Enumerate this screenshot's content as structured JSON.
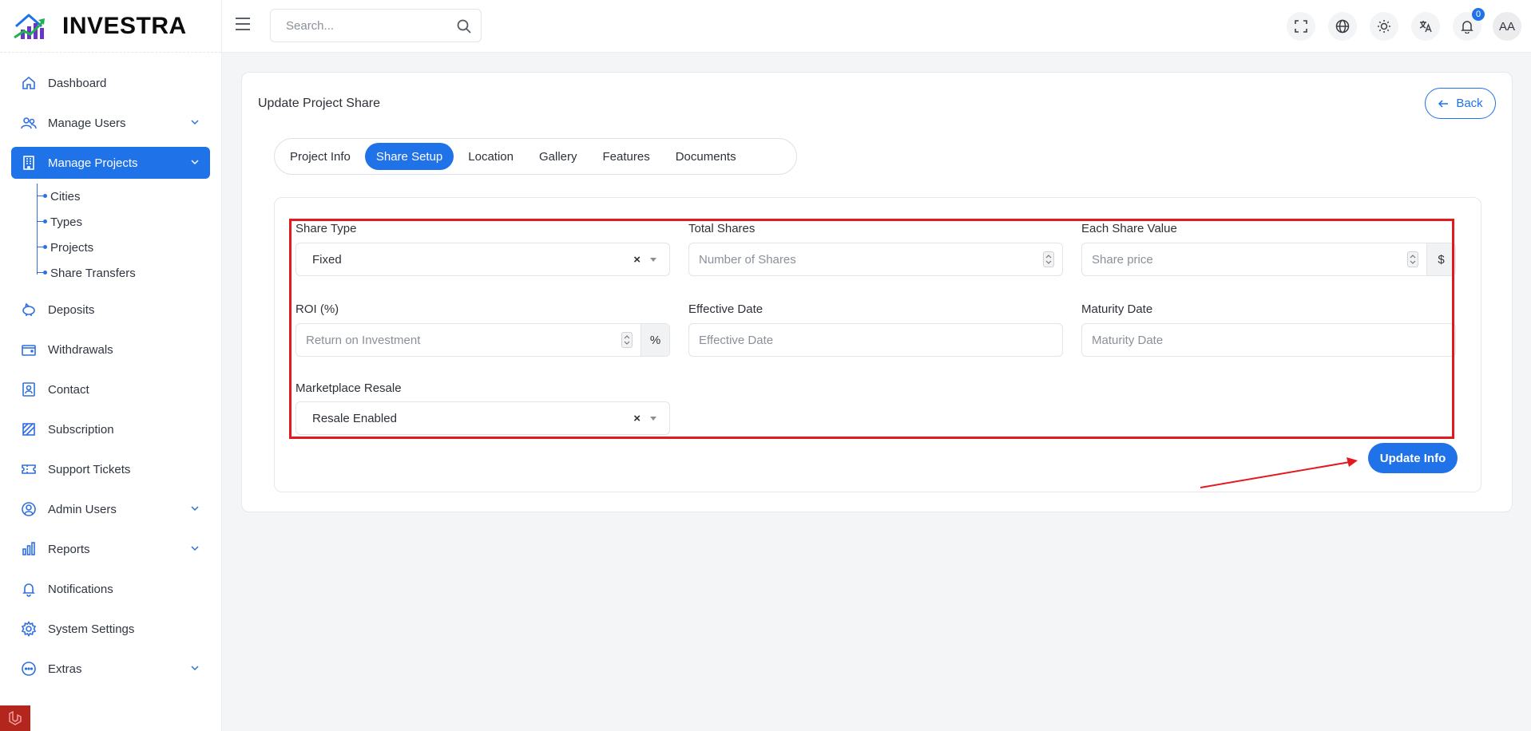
{
  "brand": {
    "name": "INVESTRA"
  },
  "search": {
    "placeholder": "Search..."
  },
  "header": {
    "notification_count": "0",
    "avatar_initials": "AA"
  },
  "sidebar": {
    "items": [
      {
        "label": "Dashboard",
        "icon": "home-icon"
      },
      {
        "label": "Manage Users",
        "icon": "users-icon",
        "has_children": true
      },
      {
        "label": "Manage Projects",
        "icon": "building-icon",
        "has_children": true,
        "active": true,
        "children": [
          "Cities",
          "Types",
          "Projects",
          "Share Transfers"
        ]
      },
      {
        "label": "Deposits",
        "icon": "piggy-bank-icon"
      },
      {
        "label": "Withdrawals",
        "icon": "wallet-icon"
      },
      {
        "label": "Contact",
        "icon": "contact-icon"
      },
      {
        "label": "Subscription",
        "icon": "subscription-icon"
      },
      {
        "label": "Support Tickets",
        "icon": "ticket-icon"
      },
      {
        "label": "Admin Users",
        "icon": "admin-user-icon",
        "has_children": true
      },
      {
        "label": "Reports",
        "icon": "bar-chart-icon",
        "has_children": true
      },
      {
        "label": "Notifications",
        "icon": "bell-icon"
      },
      {
        "label": "System Settings",
        "icon": "gear-icon"
      },
      {
        "label": "Extras",
        "icon": "more-circle-icon",
        "has_children": true
      }
    ]
  },
  "page": {
    "title": "Update Project Share",
    "back_label": "Back",
    "tabs": [
      "Project Info",
      "Share Setup",
      "Location",
      "Gallery",
      "Features",
      "Documents"
    ],
    "active_tab": "Share Setup"
  },
  "form": {
    "share_type": {
      "label": "Share Type",
      "value": "Fixed",
      "clear": "×"
    },
    "total_shares": {
      "label": "Total Shares",
      "placeholder": "Number of Shares"
    },
    "each_share_value": {
      "label": "Each Share Value",
      "placeholder": "Share price",
      "addon": "$"
    },
    "roi": {
      "label": "ROI (%)",
      "placeholder": "Return on Investment",
      "addon": "%"
    },
    "effective_date": {
      "label": "Effective Date",
      "placeholder": "Effective Date"
    },
    "maturity_date": {
      "label": "Maturity Date",
      "placeholder": "Maturity Date"
    },
    "marketplace_resale": {
      "label": "Marketplace Resale",
      "value": "Resale Enabled",
      "clear": "×"
    },
    "submit_label": "Update Info"
  },
  "colors": {
    "primary": "#1f72e8",
    "annotation_red": "#e3191e"
  }
}
